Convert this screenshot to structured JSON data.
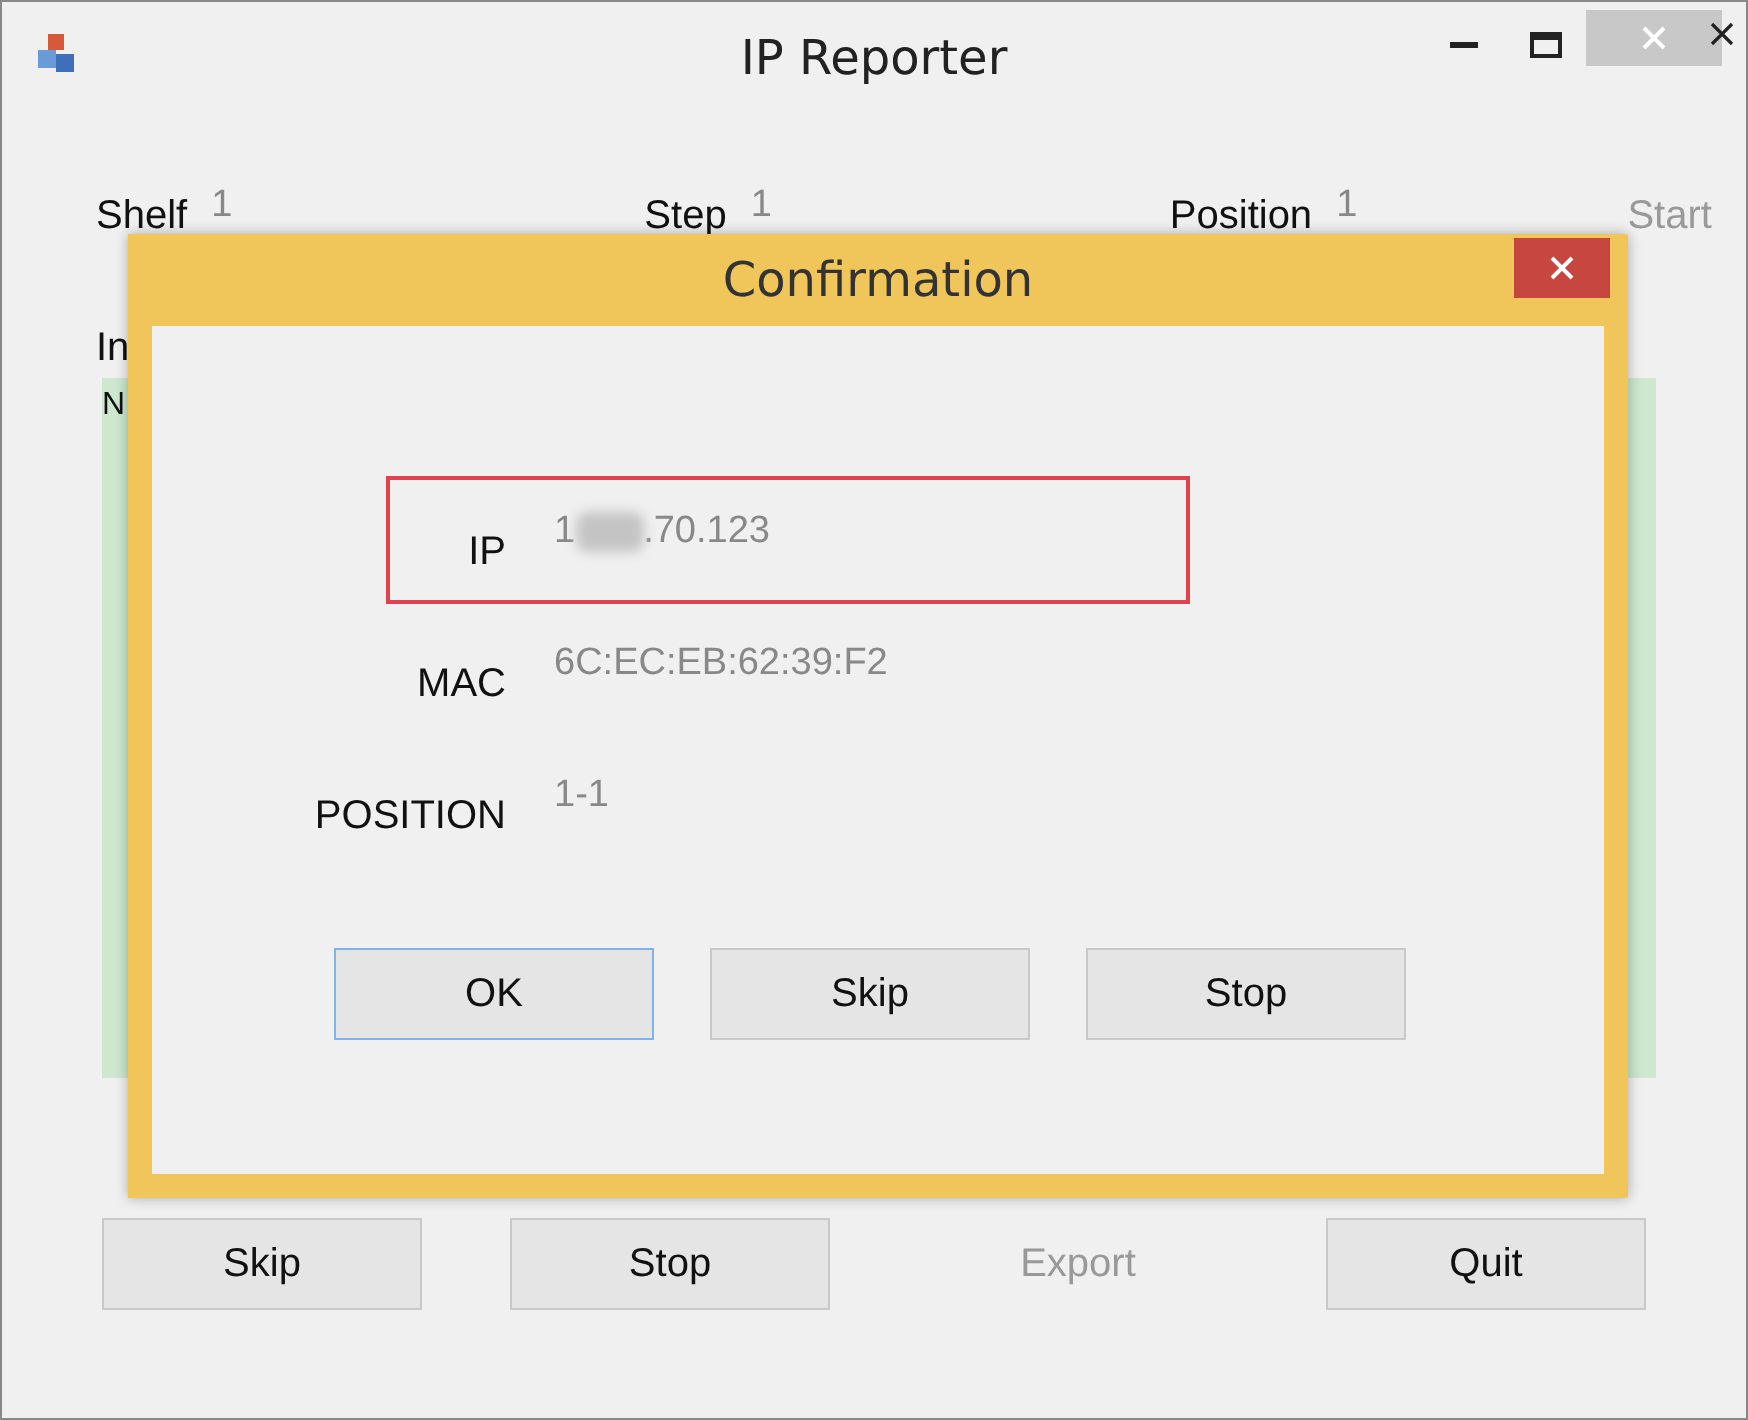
{
  "window": {
    "title": "IP Reporter"
  },
  "fields": [
    {
      "label": "Shelf",
      "value": "1"
    },
    {
      "label": "Step",
      "value": "1"
    },
    {
      "label": "Position",
      "value": "1"
    }
  ],
  "start_button": {
    "label": "Start",
    "disabled": true
  },
  "list": {
    "label": "In",
    "column_1": "N"
  },
  "dialog": {
    "title": "Confirmation",
    "rows": [
      {
        "label": "IP",
        "value_start": "1",
        "value_end": ".70.123",
        "redacted": true,
        "highlighted": true
      },
      {
        "label": "MAC",
        "value_start": "6C:EC:EB:62:39:F2",
        "redacted": false,
        "highlighted": false
      },
      {
        "label": "POSITION",
        "value_start": "1-1",
        "redacted": false,
        "highlighted": false
      }
    ],
    "buttons": [
      {
        "label": "OK",
        "focused": true
      },
      {
        "label": "Skip",
        "focused": false
      },
      {
        "label": "Stop",
        "focused": false
      }
    ]
  },
  "buttons": [
    {
      "label": "Skip",
      "disabled": false
    },
    {
      "label": "Stop",
      "disabled": false
    },
    {
      "label": "Export",
      "disabled": true
    },
    {
      "label": "Quit",
      "disabled": false
    }
  ]
}
